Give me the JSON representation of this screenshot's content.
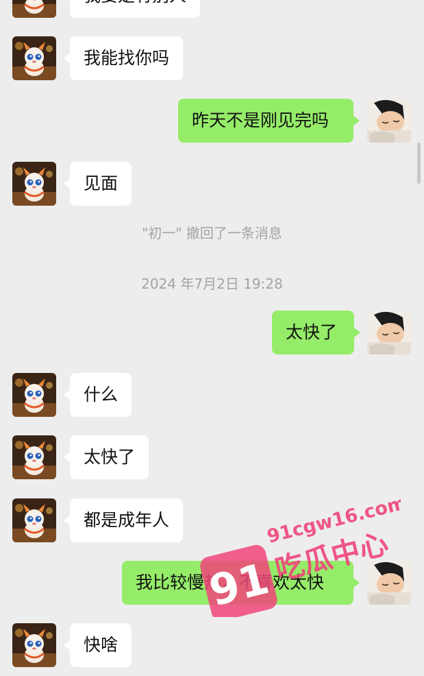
{
  "contacts": {
    "left_name": "初一"
  },
  "messages": [
    {
      "id": "m0",
      "side": "in",
      "text": "我要是有别人"
    },
    {
      "id": "m1",
      "side": "in",
      "text": "我能找你吗"
    },
    {
      "id": "m2",
      "side": "out",
      "text": "昨天不是刚见完吗"
    },
    {
      "id": "m3",
      "side": "in",
      "text": "见面"
    },
    {
      "id": "m6",
      "side": "out",
      "text": "太快了"
    },
    {
      "id": "m7",
      "side": "in",
      "text": "什么"
    },
    {
      "id": "m8",
      "side": "in",
      "text": "太快了"
    },
    {
      "id": "m9",
      "side": "in",
      "text": "都是成年人"
    },
    {
      "id": "m10",
      "side": "out",
      "text": "我比较慢热，不喜欢太快"
    },
    {
      "id": "m11",
      "side": "in",
      "text": "快啥"
    }
  ],
  "system": {
    "recall": "\"初一\" 撤回了一条消息",
    "timestamp": "2024 年7月2日 19:28"
  },
  "watermark": {
    "number": "91",
    "domain": "91cgw16.com",
    "brand": "吃瓜中心",
    "color": "#f0457a"
  },
  "colors": {
    "background": "#ededed",
    "incoming_bubble": "#ffffff",
    "outgoing_bubble": "#95ec69"
  },
  "icons": {
    "left_avatar": "dragon-mascot-avatar",
    "right_avatar": "sleeping-boy-avatar"
  }
}
